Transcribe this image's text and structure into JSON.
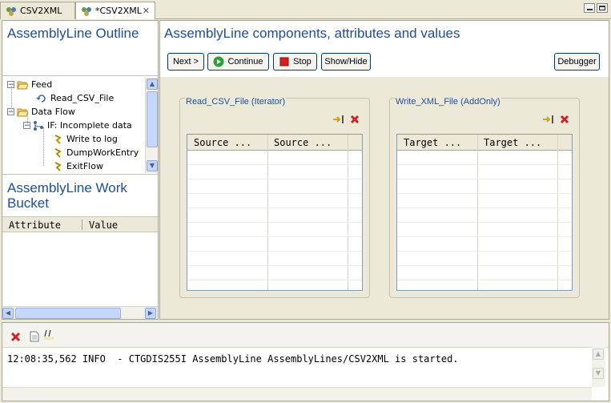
{
  "tabs": [
    {
      "label": "CSV2XML",
      "active": false
    },
    {
      "label": "*CSV2XML",
      "active": true
    }
  ],
  "outline": {
    "title": "AssemblyLine Outline",
    "tree": [
      {
        "label": "Feed",
        "type": "folder",
        "expanded": true
      },
      {
        "label": "Read_CSV_File",
        "type": "component"
      },
      {
        "label": "Data Flow",
        "type": "folder",
        "expanded": true
      },
      {
        "label": "IF: Incomplete data",
        "type": "branch",
        "expanded": true
      },
      {
        "label": "Write to log",
        "type": "script"
      },
      {
        "label": "DumpWorkEntry",
        "type": "script"
      },
      {
        "label": "ExitFlow",
        "type": "script"
      }
    ]
  },
  "work_bucket": {
    "title_line1": "AssemblyLine Work",
    "title_line2": "Bucket",
    "columns": [
      "Attribute",
      "Value"
    ]
  },
  "main": {
    "title": "AssemblyLine components, attributes and values",
    "buttons": {
      "next": "Next >",
      "continue": "Continue",
      "stop": "Stop",
      "showhide": "Show/Hide",
      "debugger": "Debugger"
    },
    "components": [
      {
        "label": "Read_CSV_File (Iterator)",
        "columns": [
          "Source ...",
          "Source ..."
        ]
      },
      {
        "label": "Write_XML_File (AddOnly)",
        "columns": [
          "Target ...",
          "Target ..."
        ]
      }
    ]
  },
  "console": {
    "log": "12:08:35,562 INFO  - CTGDIS255I AssemblyLine AssemblyLines/CSV2XML is started."
  },
  "colors": {
    "title_blue": "#1c4e9c",
    "stop_red": "#d42020",
    "continue_green": "#2e9e3a"
  }
}
